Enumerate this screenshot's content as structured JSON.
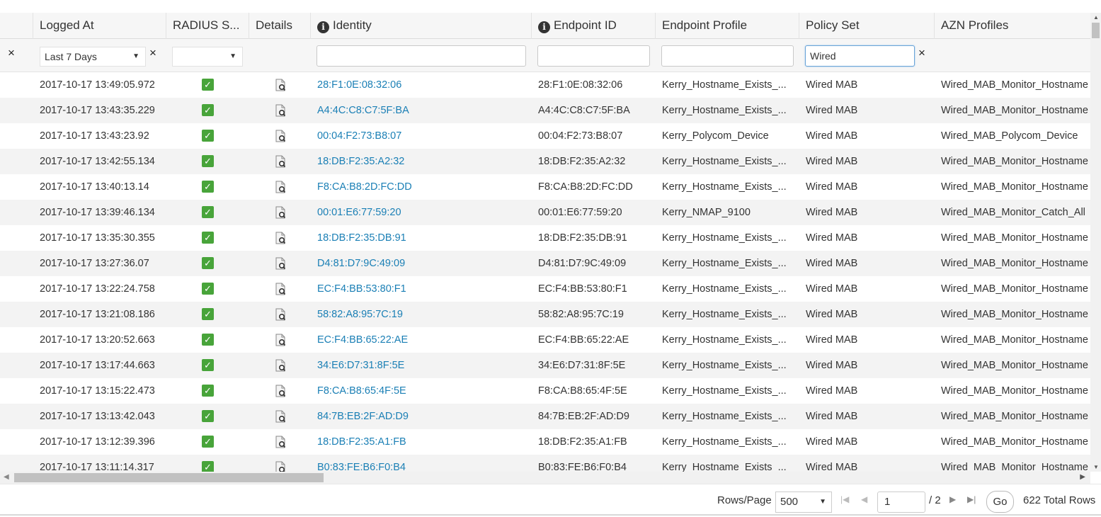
{
  "columns": {
    "logged_at": "Logged At",
    "radius_status": "RADIUS S...",
    "details": "Details",
    "identity": "Identity",
    "endpoint_id": "Endpoint ID",
    "endpoint_profile": "Endpoint Profile",
    "policy_set": "Policy Set",
    "azn_profiles": "AZN Profiles"
  },
  "filters": {
    "clear_all": "×",
    "time_range": "Last 7 Days",
    "time_clear": "×",
    "policy_set_value": "Wired",
    "policy_set_clear": "×"
  },
  "rows": [
    {
      "logged_at": "2017-10-17 13:49:05.972",
      "identity": "28:F1:0E:08:32:06",
      "endpoint_id": "28:F1:0E:08:32:06",
      "endpoint_profile": "Kerry_Hostname_Exists_...",
      "policy_set": "Wired MAB",
      "azn_profile": "Wired_MAB_Monitor_Hostname"
    },
    {
      "logged_at": "2017-10-17 13:43:35.229",
      "identity": "A4:4C:C8:C7:5F:BA",
      "endpoint_id": "A4:4C:C8:C7:5F:BA",
      "endpoint_profile": "Kerry_Hostname_Exists_...",
      "policy_set": "Wired MAB",
      "azn_profile": "Wired_MAB_Monitor_Hostname"
    },
    {
      "logged_at": "2017-10-17 13:43:23.92",
      "identity": "00:04:F2:73:B8:07",
      "endpoint_id": "00:04:F2:73:B8:07",
      "endpoint_profile": "Kerry_Polycom_Device",
      "policy_set": "Wired MAB",
      "azn_profile": "Wired_MAB_Polycom_Device"
    },
    {
      "logged_at": "2017-10-17 13:42:55.134",
      "identity": "18:DB:F2:35:A2:32",
      "endpoint_id": "18:DB:F2:35:A2:32",
      "endpoint_profile": "Kerry_Hostname_Exists_...",
      "policy_set": "Wired MAB",
      "azn_profile": "Wired_MAB_Monitor_Hostname"
    },
    {
      "logged_at": "2017-10-17 13:40:13.14",
      "identity": "F8:CA:B8:2D:FC:DD",
      "endpoint_id": "F8:CA:B8:2D:FC:DD",
      "endpoint_profile": "Kerry_Hostname_Exists_...",
      "policy_set": "Wired MAB",
      "azn_profile": "Wired_MAB_Monitor_Hostname"
    },
    {
      "logged_at": "2017-10-17 13:39:46.134",
      "identity": "00:01:E6:77:59:20",
      "endpoint_id": "00:01:E6:77:59:20",
      "endpoint_profile": "Kerry_NMAP_9100",
      "policy_set": "Wired MAB",
      "azn_profile": "Wired_MAB_Monitor_Catch_All"
    },
    {
      "logged_at": "2017-10-17 13:35:30.355",
      "identity": "18:DB:F2:35:DB:91",
      "endpoint_id": "18:DB:F2:35:DB:91",
      "endpoint_profile": "Kerry_Hostname_Exists_...",
      "policy_set": "Wired MAB",
      "azn_profile": "Wired_MAB_Monitor_Hostname"
    },
    {
      "logged_at": "2017-10-17 13:27:36.07",
      "identity": "D4:81:D7:9C:49:09",
      "endpoint_id": "D4:81:D7:9C:49:09",
      "endpoint_profile": "Kerry_Hostname_Exists_...",
      "policy_set": "Wired MAB",
      "azn_profile": "Wired_MAB_Monitor_Hostname"
    },
    {
      "logged_at": "2017-10-17 13:22:24.758",
      "identity": "EC:F4:BB:53:80:F1",
      "endpoint_id": "EC:F4:BB:53:80:F1",
      "endpoint_profile": "Kerry_Hostname_Exists_...",
      "policy_set": "Wired MAB",
      "azn_profile": "Wired_MAB_Monitor_Hostname"
    },
    {
      "logged_at": "2017-10-17 13:21:08.186",
      "identity": "58:82:A8:95:7C:19",
      "endpoint_id": "58:82:A8:95:7C:19",
      "endpoint_profile": "Kerry_Hostname_Exists_...",
      "policy_set": "Wired MAB",
      "azn_profile": "Wired_MAB_Monitor_Hostname"
    },
    {
      "logged_at": "2017-10-17 13:20:52.663",
      "identity": "EC:F4:BB:65:22:AE",
      "endpoint_id": "EC:F4:BB:65:22:AE",
      "endpoint_profile": "Kerry_Hostname_Exists_...",
      "policy_set": "Wired MAB",
      "azn_profile": "Wired_MAB_Monitor_Hostname"
    },
    {
      "logged_at": "2017-10-17 13:17:44.663",
      "identity": "34:E6:D7:31:8F:5E",
      "endpoint_id": "34:E6:D7:31:8F:5E",
      "endpoint_profile": "Kerry_Hostname_Exists_...",
      "policy_set": "Wired MAB",
      "azn_profile": "Wired_MAB_Monitor_Hostname"
    },
    {
      "logged_at": "2017-10-17 13:15:22.473",
      "identity": "F8:CA:B8:65:4F:5E",
      "endpoint_id": "F8:CA:B8:65:4F:5E",
      "endpoint_profile": "Kerry_Hostname_Exists_...",
      "policy_set": "Wired MAB",
      "azn_profile": "Wired_MAB_Monitor_Hostname"
    },
    {
      "logged_at": "2017-10-17 13:13:42.043",
      "identity": "84:7B:EB:2F:AD:D9",
      "endpoint_id": "84:7B:EB:2F:AD:D9",
      "endpoint_profile": "Kerry_Hostname_Exists_...",
      "policy_set": "Wired MAB",
      "azn_profile": "Wired_MAB_Monitor_Hostname"
    },
    {
      "logged_at": "2017-10-17 13:12:39.396",
      "identity": "18:DB:F2:35:A1:FB",
      "endpoint_id": "18:DB:F2:35:A1:FB",
      "endpoint_profile": "Kerry_Hostname_Exists_...",
      "policy_set": "Wired MAB",
      "azn_profile": "Wired_MAB_Monitor_Hostname"
    },
    {
      "logged_at": "2017-10-17 13:11:14.317",
      "identity": "B0:83:FE:B6:F0:B4",
      "endpoint_id": "B0:83:FE:B6:F0:B4",
      "endpoint_profile": "Kerry_Hostname_Exists_...",
      "policy_set": "Wired MAB",
      "azn_profile": "Wired_MAB_Monitor_Hostname"
    }
  ],
  "footer": {
    "rows_per_page_label": "Rows/Page",
    "rows_per_page_value": "500",
    "current_page": "1",
    "page_total": "/ 2",
    "go_label": "Go",
    "total_rows": "622 Total Rows"
  },
  "colors": {
    "link": "#1a7fb5",
    "status_ok": "#48a43a",
    "header_bg": "#f6f6f6",
    "row_alt": "#f3f3f3"
  }
}
